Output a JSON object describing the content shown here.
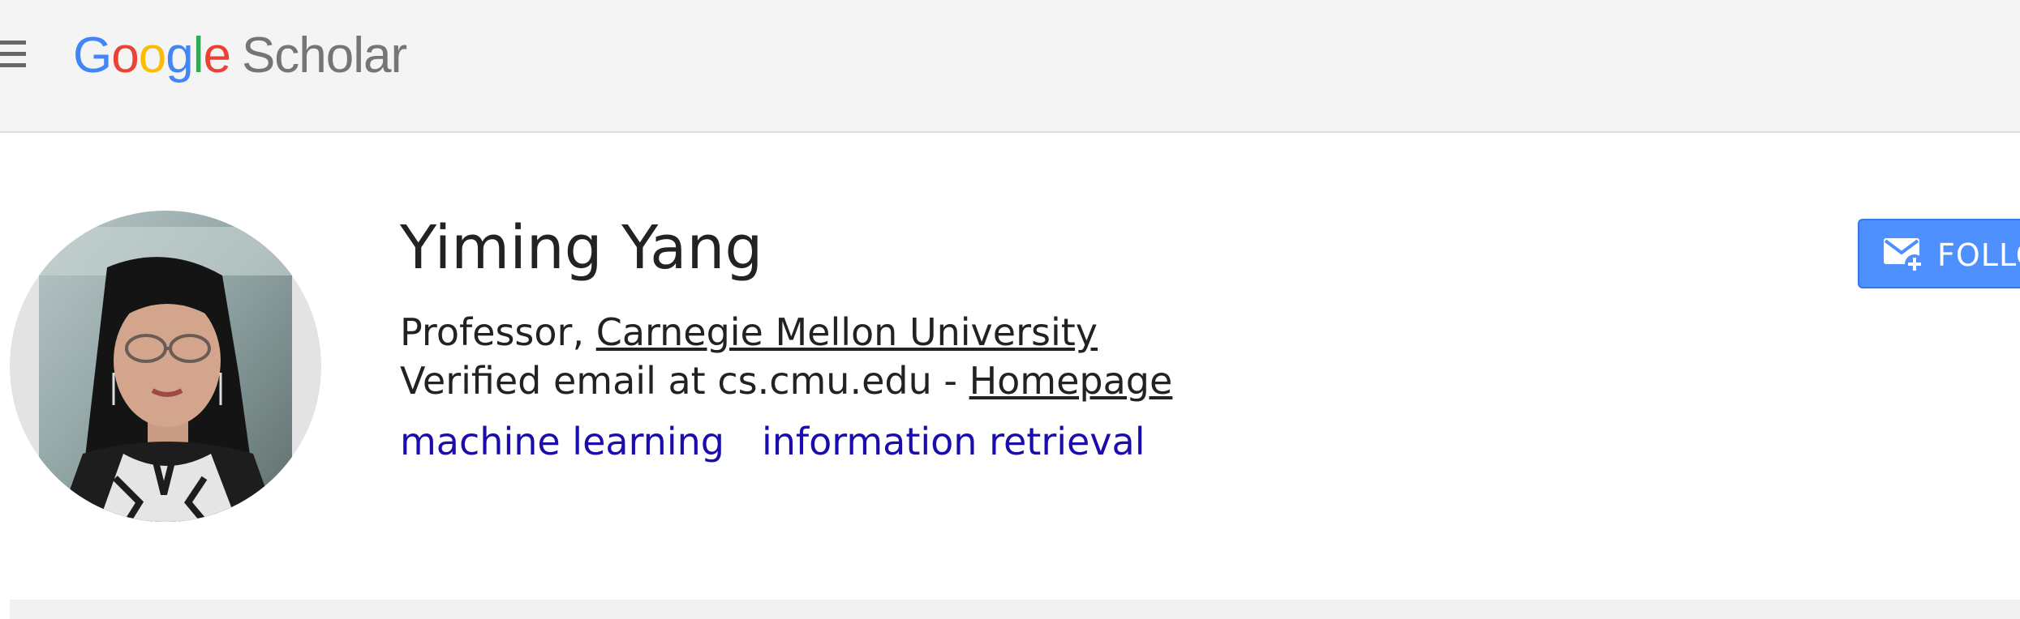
{
  "header": {
    "menu_icon": "hamburger-menu-icon",
    "logo_letters": [
      "G",
      "o",
      "o",
      "g",
      "l",
      "e"
    ],
    "product_name": "Scholar",
    "colors": {
      "blue": "#4285f4",
      "red": "#ea4335",
      "yellow": "#fbbc05",
      "green": "#34a853",
      "gray": "#757575"
    }
  },
  "profile": {
    "name": "Yiming Yang",
    "affiliation_prefix": "Professor, ",
    "affiliation_link": "Carnegie Mellon University",
    "email_text": "Verified email at cs.cmu.edu - ",
    "homepage_link": "Homepage",
    "interests": [
      "machine learning",
      "information retrieval"
    ],
    "avatar_icon": "profile-photo"
  },
  "actions": {
    "follow_label": "FOLLOW",
    "follow_icon": "mail-plus-icon",
    "follow_color": "#4d90fe"
  },
  "colors": {
    "link": "#1a0dab",
    "text": "#222222",
    "header_bg": "#f4f4f4"
  }
}
